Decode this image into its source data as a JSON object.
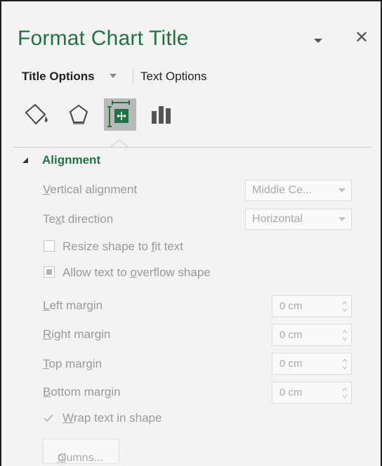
{
  "pane": {
    "title": "Format Chart Title",
    "close_icon": "close-icon",
    "menu_icon": "chevron-down-icon",
    "tabs": {
      "active": "Title Options",
      "other": "Text Options"
    },
    "icon_tabs": [
      "fill-line-icon",
      "effects-icon",
      "size-properties-icon",
      "chart-options-icon"
    ],
    "active_icon_tab": "size-properties-icon",
    "accent_color": "#217346"
  },
  "alignment": {
    "heading": "Alignment",
    "expanded": true,
    "vertical_alignment": {
      "pre": "",
      "key": "V",
      "post": "ertical alignment",
      "value": "Middle Ce..."
    },
    "text_direction": {
      "pre": "Te",
      "key": "x",
      "post": "t direction",
      "value": "Horizontal"
    },
    "resize_shape": {
      "pre": "Resize shape to ",
      "key": "f",
      "post": "it text",
      "checked": false
    },
    "allow_overflow": {
      "pre": "Allow text to ",
      "key": "o",
      "post": "verflow shape",
      "state": "indeterminate"
    },
    "margins": [
      {
        "pre": "",
        "key": "L",
        "post": "eft margin",
        "value": "0 cm"
      },
      {
        "pre": "",
        "key": "R",
        "post": "ight margin",
        "value": "0 cm"
      },
      {
        "pre": "",
        "key": "T",
        "post": "op margin",
        "value": "0 cm"
      },
      {
        "pre": "",
        "key": "B",
        "post": "ottom margin",
        "value": "0 cm"
      }
    ],
    "wrap_text": {
      "pre": "",
      "key": "W",
      "post": "rap text in shape",
      "checked": true
    },
    "columns_button": {
      "pre": "",
      "key": "C",
      "post": "olumns..."
    }
  }
}
